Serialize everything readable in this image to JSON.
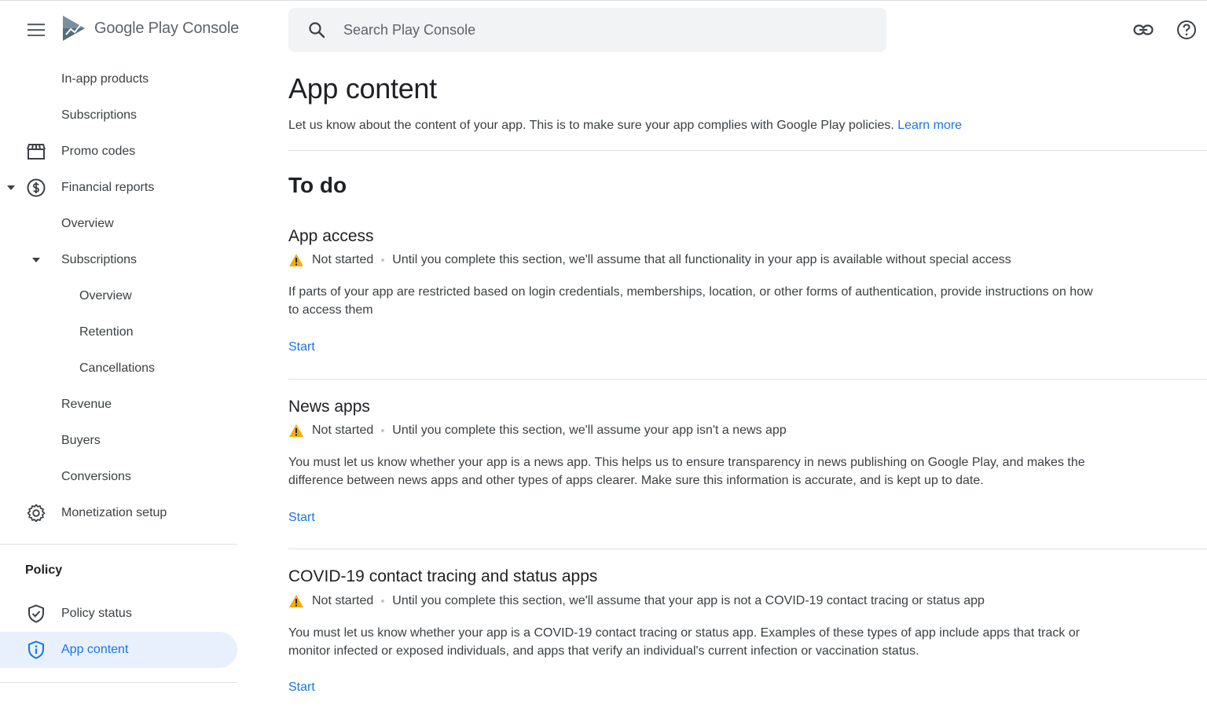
{
  "brand": {
    "logo_text_main": "Google Play",
    "logo_text_sub": "Console"
  },
  "search": {
    "placeholder": "Search Play Console"
  },
  "sidebar": {
    "items": [
      {
        "label": "In-app products"
      },
      {
        "label": "Subscriptions"
      },
      {
        "label": "Promo codes"
      },
      {
        "label": "Financial reports"
      },
      {
        "label": "Overview"
      },
      {
        "label": "Subscriptions"
      },
      {
        "label": "Overview"
      },
      {
        "label": "Retention"
      },
      {
        "label": "Cancellations"
      },
      {
        "label": "Revenue"
      },
      {
        "label": "Buyers"
      },
      {
        "label": "Conversions"
      },
      {
        "label": "Monetization setup"
      }
    ],
    "policy_section": "Policy",
    "policy_items": [
      {
        "label": "Policy status"
      },
      {
        "label": "App content"
      }
    ]
  },
  "main": {
    "title": "App content",
    "subtitle": "Let us know about the content of your app. This is to make sure your app complies with Google Play policies.",
    "learn_more": "Learn more",
    "todo_heading": "To do",
    "cards": [
      {
        "title": "App access",
        "status": "Not started",
        "status_note": "Until you complete this section, we'll assume that all functionality in your app is available without special access",
        "description": "If parts of your app are restricted based on login credentials, memberships, location, or other forms of authentication, provide instructions on how to access them",
        "action": "Start"
      },
      {
        "title": "News apps",
        "status": "Not started",
        "status_note": "Until you complete this section, we'll assume your app isn't a news app",
        "description": "You must let us know whether your app is a news app. This helps us to ensure transparency in news publishing on Google Play, and makes the difference between news apps and other types of apps clearer. Make sure this information is accurate, and is kept up to date.",
        "action": "Start"
      },
      {
        "title": "COVID-19 contact tracing and status apps",
        "status": "Not started",
        "status_note": "Until you complete this section, we'll assume that your app is not a COVID-19 contact tracing or status app",
        "description": "You must let us know whether your app is a COVID-19 contact tracing or status app. Examples of these types of app include apps that track or monitor infected or exposed individuals, and apps that verify an individual's current infection or vaccination status.",
        "action": "Start"
      }
    ]
  },
  "colors": {
    "accent": "#1a73e8",
    "warning": "#f9ab00",
    "active_bg": "#e8f0fe"
  },
  "icons": [
    "menu-icon",
    "play-console-logo",
    "search-icon",
    "link-icon",
    "help-icon",
    "promo-codes-icon",
    "dollar-icon",
    "gear-icon",
    "shield-check-icon",
    "shield-info-icon",
    "warning-icon"
  ]
}
